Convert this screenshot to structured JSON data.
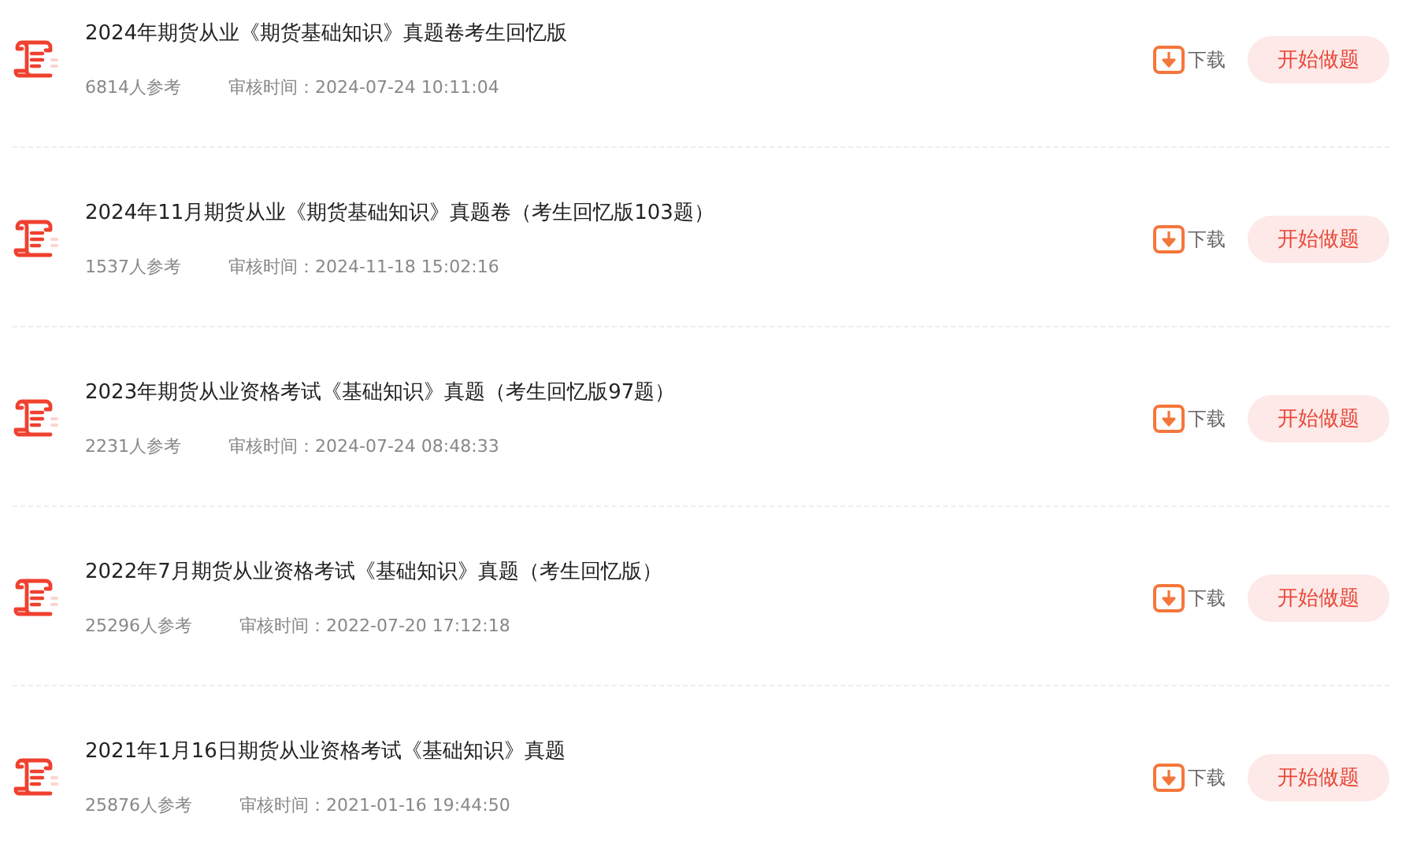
{
  "papers": [
    {
      "title": "2024年期货从业《期货基础知识》真题卷考生回忆版",
      "count": "6814人参考",
      "review_time": "审核时间：2024-07-24 10:11:04",
      "download": "下载",
      "start": "开始做题"
    },
    {
      "title": "2024年11月期货从业《期货基础知识》真题卷（考生回忆版103题）",
      "count": "1537人参考",
      "review_time": "审核时间：2024-11-18 15:02:16",
      "download": "下载",
      "start": "开始做题"
    },
    {
      "title": "2023年期货从业资格考试《基础知识》真题（考生回忆版97题）",
      "count": "2231人参考",
      "review_time": "审核时间：2024-07-24 08:48:33",
      "download": "下载",
      "start": "开始做题"
    },
    {
      "title": "2022年7月期货从业资格考试《基础知识》真题（考生回忆版）",
      "count": "25296人参考",
      "review_time": "审核时间：2022-07-20 17:12:18",
      "download": "下载",
      "start": "开始做题"
    },
    {
      "title": "2021年1月16日期货从业资格考试《基础知识》真题",
      "count": "25876人参考",
      "review_time": "审核时间：2021-01-16 19:44:50",
      "download": "下载",
      "start": "开始做题"
    }
  ]
}
